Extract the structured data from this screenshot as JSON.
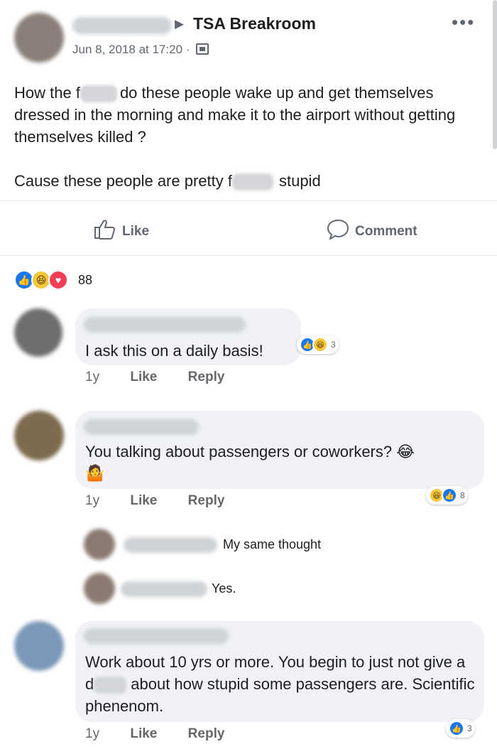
{
  "post": {
    "group_name": "TSA Breakroom",
    "arrow": "▶",
    "timestamp": "Jun 8, 2018 at 17:20 ·",
    "text_p1_a": "How the f",
    "text_p1_b": "do these people wake up and get themselves dressed in the morning and make it to the airport without getting themselves killed ?",
    "text_p2_a": "Cause these people are pretty f",
    "text_p2_b": "stupid",
    "more": "•••"
  },
  "actions": {
    "like_label": "Like",
    "comment_label": "Comment"
  },
  "reactions": {
    "count": "88",
    "icons": [
      "like-reaction",
      "haha-reaction",
      "love-reaction"
    ]
  },
  "comments": [
    {
      "text": "I ask this on a daily basis!",
      "age": "1y",
      "like": "Like",
      "reply": "Reply",
      "reaction_count": "3"
    },
    {
      "text": "You talking about passengers or coworkers? 😂",
      "emoji_line": "🤷",
      "age": "1y",
      "like": "Like",
      "reply": "Reply",
      "reaction_count": "8",
      "replies": [
        {
          "text": "My same thought"
        },
        {
          "text": "Yes."
        }
      ]
    },
    {
      "text_a": "Work about 10 yrs or more.  You begin to just not give a d",
      "text_b": "about how stupid some passengers are. Scientific phenenom.",
      "age": "1y",
      "like": "Like",
      "reply": "Reply",
      "reaction_count": "3"
    }
  ],
  "colors": {
    "facebook_blue": "#1877f2",
    "meta_gray": "#65676b",
    "bubble_bg": "#f0f2f5"
  }
}
